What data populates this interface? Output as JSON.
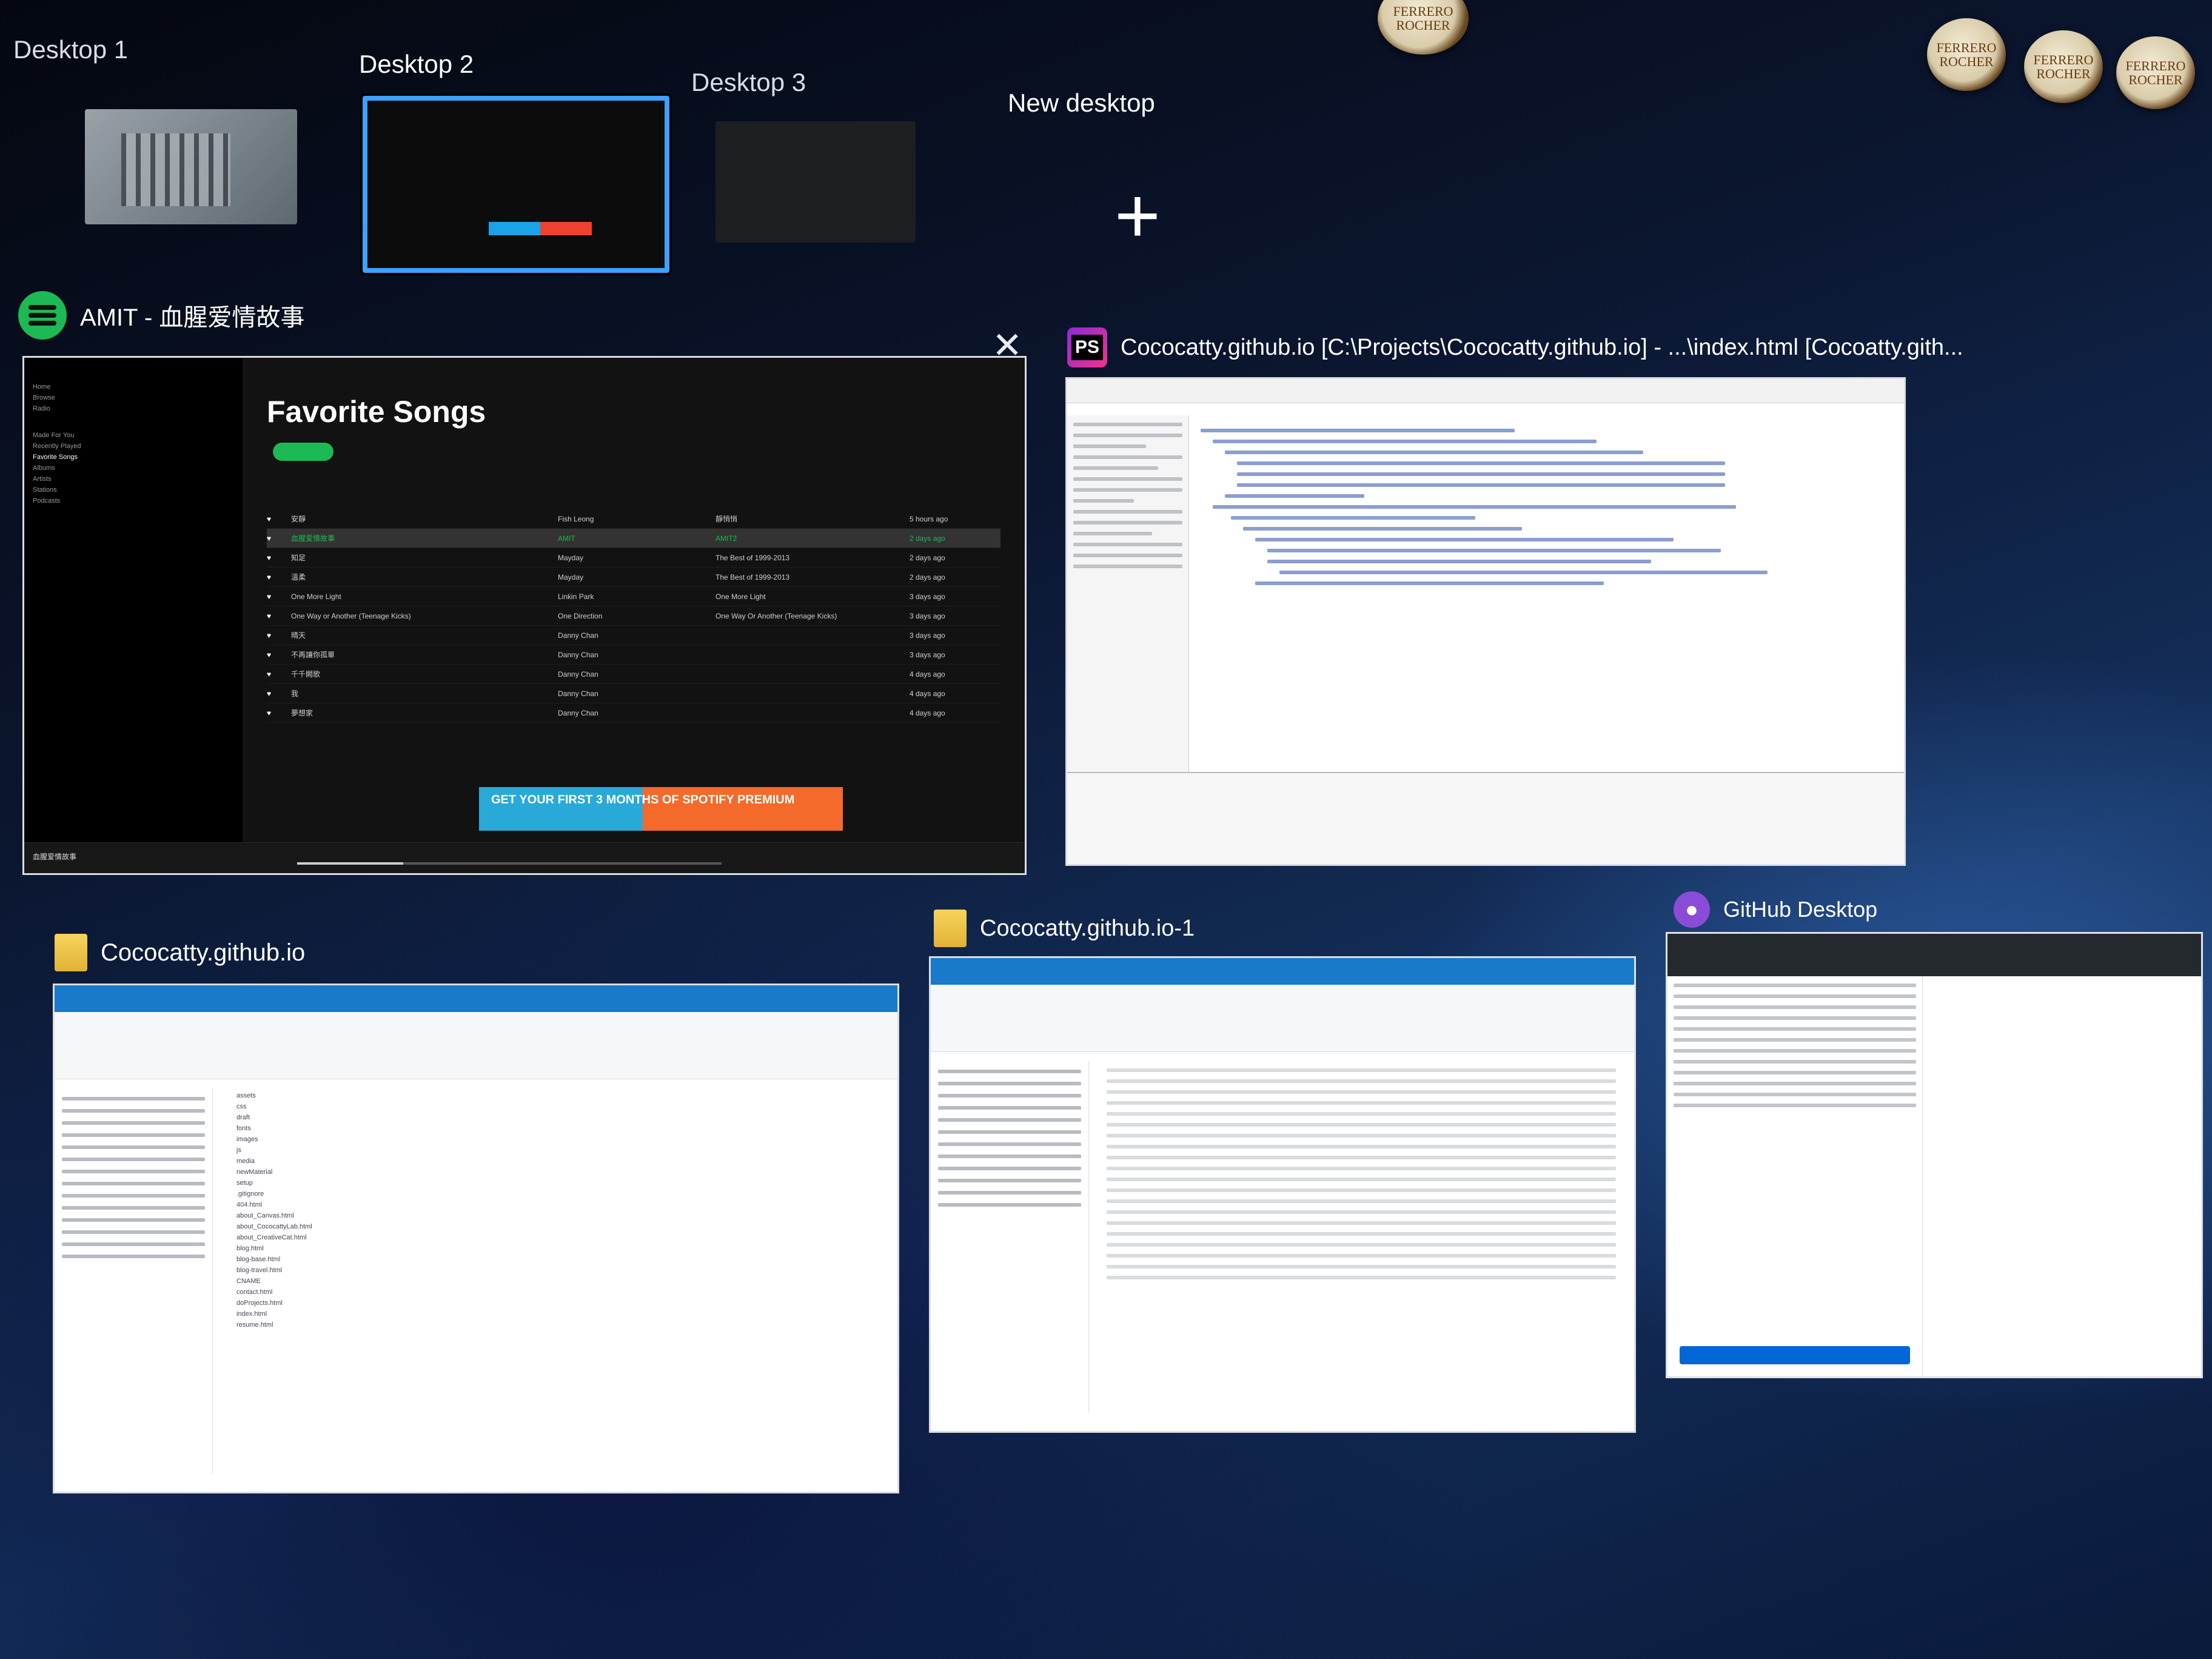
{
  "task_view": {
    "desktops": [
      {
        "label": "Desktop 1",
        "active": false
      },
      {
        "label": "Desktop 2",
        "active": true
      },
      {
        "label": "Desktop 3",
        "active": false
      }
    ],
    "new_desktop_label": "New desktop",
    "new_desktop_icon": "plus-icon"
  },
  "decor": {
    "chocolate_label": "FERRERO ROCHER"
  },
  "windows": [
    {
      "id": "spotify",
      "title": "AMIT - 血腥爱情故事",
      "icon": "spotify-icon",
      "content": {
        "heading": "Favorite Songs",
        "nav_items": [
          "Home",
          "Browse",
          "Radio",
          "Made For You",
          "Recently Played",
          "Favorite Songs",
          "Albums",
          "Artists",
          "Stations",
          "Podcasts"
        ],
        "tracks": [
          {
            "title": "安靜",
            "artist": "Fish Leong",
            "album": "靜悄悄",
            "added": "5 hours ago"
          },
          {
            "title": "血腥爱情故事",
            "artist": "AMIT",
            "album": "AMIT2",
            "added": "2 days ago"
          },
          {
            "title": "知足",
            "artist": "Mayday",
            "album": "The Best of 1999-2013",
            "added": "2 days ago"
          },
          {
            "title": "溫柔",
            "artist": "Mayday",
            "album": "The Best of 1999-2013",
            "added": "2 days ago"
          },
          {
            "title": "One More Light",
            "artist": "Linkin Park",
            "album": "One More Light",
            "added": "3 days ago"
          },
          {
            "title": "One Way or Another (Teenage Kicks)",
            "artist": "One Direction",
            "album": "One Way Or Another (Teenage Kicks)",
            "added": "3 days ago"
          },
          {
            "title": "晴天",
            "artist": "Danny Chan",
            "album": "",
            "added": "3 days ago"
          },
          {
            "title": "不再讓你孤單",
            "artist": "Danny Chan",
            "album": "",
            "added": "3 days ago"
          },
          {
            "title": "千千闕歌",
            "artist": "Danny Chan",
            "album": "",
            "added": "4 days ago"
          },
          {
            "title": "我",
            "artist": "Danny Chan",
            "album": "",
            "added": "4 days ago"
          },
          {
            "title": "夢想家",
            "artist": "Danny Chan",
            "album": "",
            "added": "4 days ago"
          }
        ],
        "ad_text": "GET YOUR FIRST 3 MONTHS OF SPOTIFY PREMIUM",
        "playing_label": "血腥爱情故事"
      }
    },
    {
      "id": "phpstorm",
      "title": "Cococatty.github.io [C:\\Projects\\Cococatty.github.io] - ...\\index.html [Cocoatty.gith...",
      "icon": "phpstorm-icon",
      "badge": "PS"
    },
    {
      "id": "explorer-1",
      "title": "Cococatty.github.io",
      "icon": "folder-icon",
      "content": {
        "items": [
          "assets",
          "css",
          "draft",
          "fonts",
          "images",
          "js",
          "media",
          "newMaterial",
          "setup",
          ".gitignore",
          "404.html",
          "about_Canvas.html",
          "about_CococattyLab.html",
          "about_CreativeCat.html",
          "blog.html",
          "blog-base.html",
          "blog-travel.html",
          "CNAME",
          "contact.html",
          "doProjects.html",
          "index.html",
          "resume.html"
        ]
      }
    },
    {
      "id": "explorer-2",
      "title": "Cococatty.github.io-1",
      "icon": "folder-icon"
    },
    {
      "id": "github",
      "title": "GitHub Desktop",
      "icon": "github-icon"
    }
  ]
}
